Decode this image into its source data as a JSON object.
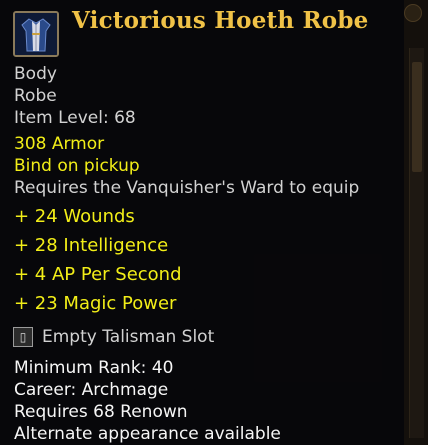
{
  "item": {
    "name": "Victorious Hoeth Robe",
    "slot": "Body",
    "type": "Robe",
    "item_level": "Item Level: 68",
    "armor": "308 Armor",
    "bind": "Bind on pickup",
    "requirement": "Requires the Vanquisher's Ward to equip",
    "stats": [
      "+ 24 Wounds",
      "+ 28 Intelligence",
      "+ 4 AP Per Second",
      "+ 23 Magic Power"
    ],
    "talisman_slot": "Empty Talisman Slot",
    "minimum_rank": "Minimum Rank: 40",
    "career": "Career: Archmage",
    "renown": "Requires 68 Renown",
    "appearance": "Alternate appearance available",
    "icon": "robe-icon",
    "talisman_icon": "talisman-slot-icon",
    "colors": {
      "title": "#f0c247",
      "bonus": "#f2ee18",
      "basic": "#d2d2d2",
      "white": "#f6f6f6"
    }
  }
}
